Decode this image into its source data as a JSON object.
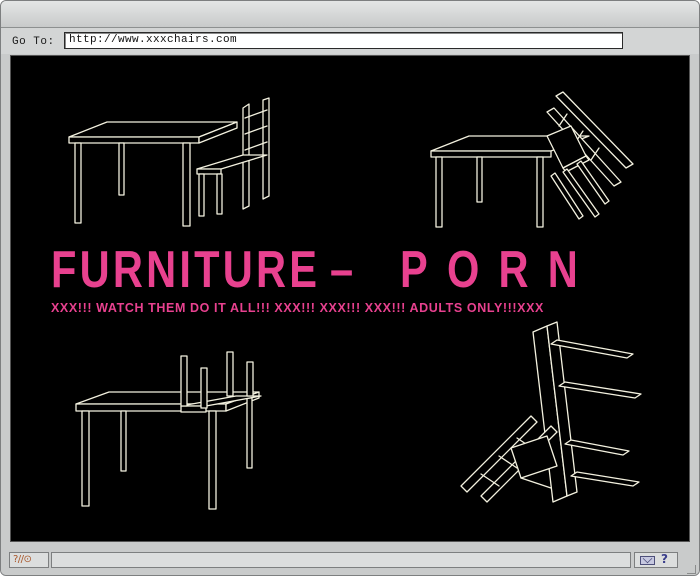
{
  "browser": {
    "goto_label": "Go To:",
    "url": "http://www.xxxchairs.com"
  },
  "page": {
    "headline_left": "FURNITURE",
    "headline_dash": "–",
    "headline_right": "PORN",
    "subline": "XXX!!! WATCH THEM DO IT ALL!!! XXX!!! XXX!!!  XXX!!! ADULTS ONLY!!!XXX",
    "accent_color": "#e8418f",
    "background_color": "#000000",
    "line_art_color": "#f3f1df",
    "illustrations": [
      "table-and-chair",
      "chair-tipped-over-table",
      "chair-upside-down-on-table",
      "table-and-chair-tumbled"
    ]
  },
  "statusbar": {
    "left_icon": "security-icon",
    "left_glyph": "?//⊙",
    "right_icons": [
      "mail-icon",
      "help-icon"
    ],
    "help_glyph": "?"
  }
}
